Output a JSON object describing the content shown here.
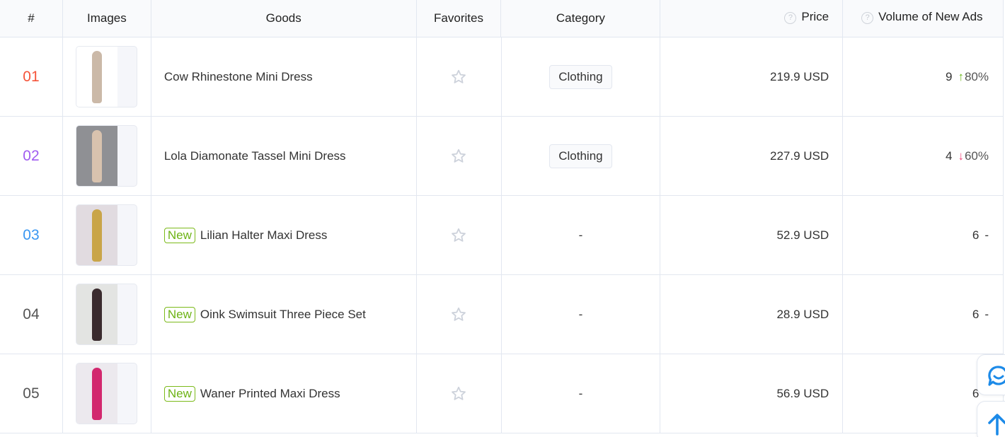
{
  "colors": {
    "rank_colors": [
      "#f5543a",
      "#a05cf0",
      "#3a97f2",
      "#555555",
      "#555555"
    ],
    "up": "#6bb81a",
    "down": "#f0457a",
    "new_tag": "#6db315",
    "accent": "#1c8ae8"
  },
  "table": {
    "headers": {
      "rank": "#",
      "images": "Images",
      "goods": "Goods",
      "favorites": "Favorites",
      "category": "Category",
      "price": "Price",
      "volume": "Volume of New Ads"
    },
    "help_icon": "?",
    "rows": [
      {
        "rank": "01",
        "is_new": false,
        "new_label": "",
        "name": "Cow Rhinestone Mini Dress",
        "category": "Clothing",
        "price": "219.9 USD",
        "volume": "9",
        "trend": "up",
        "trend_arrow": "↑",
        "change": "80%",
        "image": "beige-rhinestone-dress"
      },
      {
        "rank": "02",
        "is_new": false,
        "new_label": "",
        "name": "Lola Diamonate Tassel Mini Dress",
        "category": "Clothing",
        "price": "227.9 USD",
        "volume": "4",
        "trend": "down",
        "trend_arrow": "↓",
        "change": "60%",
        "image": "nude-tassel-dress"
      },
      {
        "rank": "03",
        "is_new": true,
        "new_label": "New",
        "name": "Lilian Halter Maxi Dress",
        "category": "-",
        "price": "52.9 USD",
        "volume": "6",
        "trend": "none",
        "trend_arrow": "",
        "change": "-",
        "image": "gold-halter-dress"
      },
      {
        "rank": "04",
        "is_new": true,
        "new_label": "New",
        "name": "Oink Swimsuit Three Piece Set",
        "category": "-",
        "price": "28.9 USD",
        "volume": "6",
        "trend": "none",
        "trend_arrow": "",
        "change": "-",
        "image": "floral-swimsuit-set"
      },
      {
        "rank": "05",
        "is_new": true,
        "new_label": "New",
        "name": "Waner Printed Maxi Dress",
        "category": "-",
        "price": "56.9 USD",
        "volume": "6",
        "trend": "none",
        "trend_arrow": "",
        "change": "-",
        "image": "pink-printed-maxi-dress"
      }
    ]
  },
  "floating": {
    "chat_icon": "chat-smile-icon",
    "top_icon": "arrow-up-icon"
  }
}
